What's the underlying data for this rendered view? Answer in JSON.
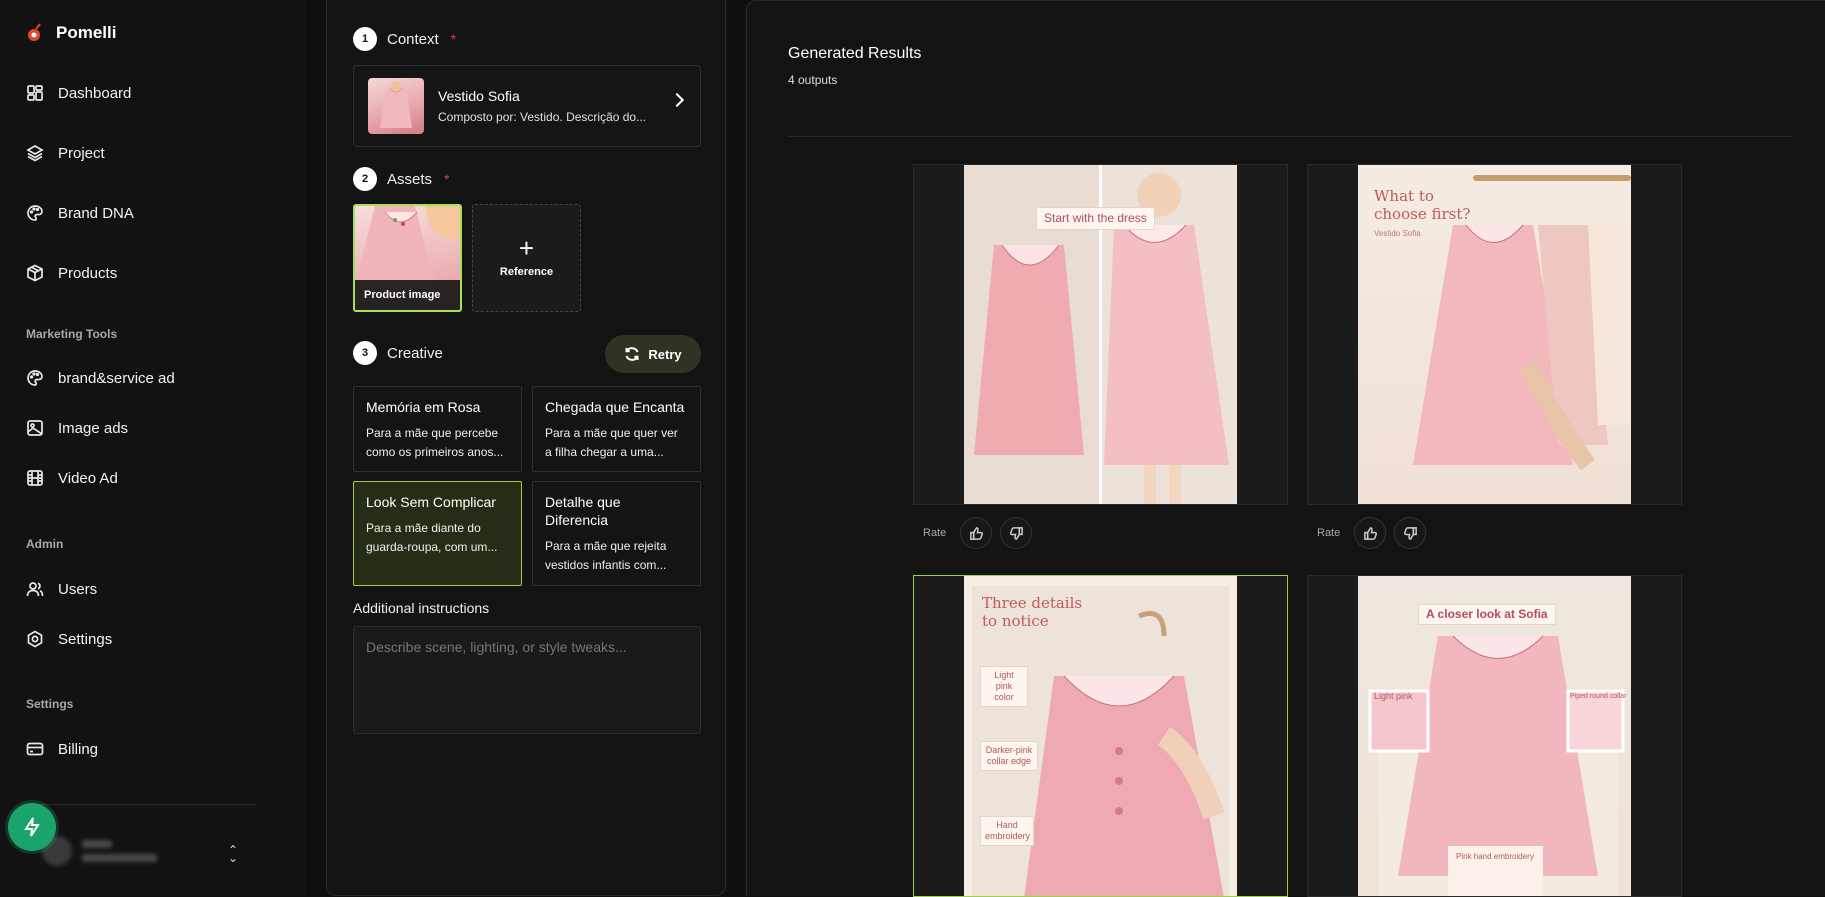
{
  "app": {
    "name": "Pomelli"
  },
  "sidebar": {
    "main_items": [
      {
        "label": "Dashboard",
        "icon": "dashboard-icon"
      },
      {
        "label": "Project",
        "icon": "layers-icon"
      },
      {
        "label": "Brand DNA",
        "icon": "palette-icon"
      },
      {
        "label": "Products",
        "icon": "box-icon"
      }
    ],
    "marketing_label": "Marketing Tools",
    "marketing_items": [
      {
        "label": "brand&service ad",
        "icon": "palette-icon"
      },
      {
        "label": "Image ads",
        "icon": "image-icon"
      },
      {
        "label": "Video Ad",
        "icon": "film-icon"
      }
    ],
    "admin_label": "Admin",
    "admin_items": [
      {
        "label": "Users",
        "icon": "users-icon"
      },
      {
        "label": "Settings",
        "icon": "gear-icon"
      }
    ],
    "settings_label": "Settings",
    "settings_items": [
      {
        "label": "Billing",
        "icon": "credit-card-icon"
      }
    ]
  },
  "form": {
    "step1": {
      "num": "1",
      "label": "Context",
      "required": "*"
    },
    "context": {
      "title": "Vestido Sofia",
      "subtitle": "Composto por: Vestido. Descrição do..."
    },
    "step2": {
      "num": "2",
      "label": "Assets",
      "required": "*"
    },
    "assets": {
      "product_label": "Product image",
      "reference_label": "Reference"
    },
    "step3": {
      "num": "3",
      "label": "Creative"
    },
    "retry_label": "Retry",
    "creatives": [
      {
        "title": "Memória em Rosa",
        "desc1": "Para a mãe que percebe",
        "desc2": "como os primeiros anos..."
      },
      {
        "title": "Chegada que Encanta",
        "desc1": "Para a mãe que quer ver",
        "desc2": "a filha chegar a uma..."
      },
      {
        "title": "Look Sem Complicar",
        "desc1": "Para a mãe diante do",
        "desc2": "guarda-roupa, com um..."
      },
      {
        "title": "Detalhe que Diferencia",
        "desc1": "Para a mãe que rejeita",
        "desc2": "vestidos infantis com..."
      }
    ],
    "additional_label": "Additional instructions",
    "additional_placeholder": "Describe scene, lighting, or style tweaks..."
  },
  "results": {
    "title": "Generated Results",
    "count": "4 outputs",
    "rate_label": "Rate",
    "images": [
      {
        "overlay": "Start with the dress"
      },
      {
        "overlay_line1": "What to",
        "overlay_line2": "choose first?",
        "overlay_sub": "Vestido Sofia"
      },
      {
        "overlay_line1": "Three details",
        "overlay_line2": "to notice",
        "tags": [
          "Light pink color",
          "Darker-pink collar edge",
          "Hand embroidery"
        ]
      },
      {
        "overlay": "A closer look at Sofia",
        "tags": [
          "Light pink",
          "Piped round collar",
          "Pink hand embroidery"
        ]
      }
    ]
  },
  "colors": {
    "accent_green": "#9ad04a",
    "fab_green": "#1aa36b",
    "required_red": "#e04040"
  }
}
